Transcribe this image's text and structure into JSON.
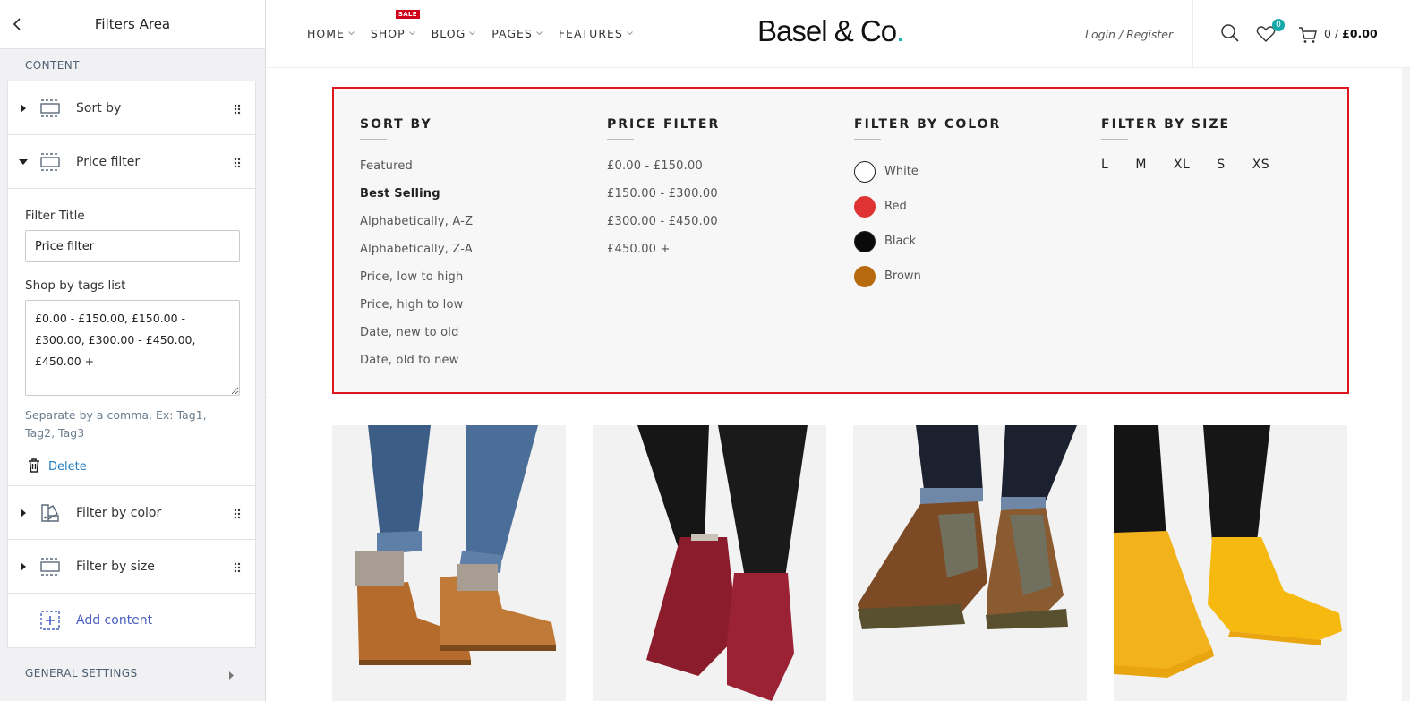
{
  "editor": {
    "title": "Filters Area",
    "content_section": "CONTENT",
    "blocks": [
      {
        "label": "Sort by",
        "expanded": false
      },
      {
        "label": "Price filter",
        "expanded": true
      },
      {
        "label": "Filter by color",
        "expanded": false
      },
      {
        "label": "Filter by size",
        "expanded": false
      }
    ],
    "price_block": {
      "filter_title_label": "Filter Title",
      "filter_title_value": "Price filter",
      "tags_label": "Shop by tags list",
      "tags_value": "£0.00 - £150.00, £150.00 - £300.00, £300.00 - £450.00, £450.00 +",
      "help_text": "Separate by a comma, Ex: Tag1, Tag2, Tag3",
      "delete_label": "Delete"
    },
    "add_content_label": "Add content",
    "general_settings": "GENERAL SETTINGS"
  },
  "store": {
    "nav": [
      {
        "label": "HOME",
        "dropdown": true
      },
      {
        "label": "SHOP",
        "dropdown": true,
        "badge": "SALE"
      },
      {
        "label": "BLOG",
        "dropdown": true
      },
      {
        "label": "PAGES",
        "dropdown": true
      },
      {
        "label": "FEATURES",
        "dropdown": true
      }
    ],
    "logo_text": "Basel & Co",
    "logo_dot": ".",
    "login": "Login / Register",
    "wishlist_count": "0",
    "cart_count": "0 / ",
    "cart_total": "£0.00",
    "accent_color": "#16a9a9",
    "filters": {
      "sort_by": {
        "title": "SORT BY",
        "items": [
          "Featured",
          "Best Selling",
          "Alphabetically, A-Z",
          "Alphabetically, Z-A",
          "Price, low to high",
          "Price, high to low",
          "Date, new to old",
          "Date, old to new"
        ],
        "active": "Best Selling"
      },
      "price_filter": {
        "title": "PRICE FILTER",
        "items": [
          "£0.00 - £150.00",
          "£150.00 - £300.00",
          "£300.00 - £450.00",
          "£450.00 +"
        ]
      },
      "color_filter": {
        "title": "FILTER BY COLOR",
        "items": [
          {
            "label": "White",
            "color": "#ffffff"
          },
          {
            "label": "Red",
            "color": "#e03434"
          },
          {
            "label": "Black",
            "color": "#0a0a0a"
          },
          {
            "label": "Brown",
            "color": "#b86a0e"
          }
        ]
      },
      "size_filter": {
        "title": "FILTER BY SIZE",
        "items": [
          "L",
          "M",
          "XL",
          "S",
          "XS"
        ]
      }
    },
    "products": [
      {
        "image": "tan suede desert boots with jeans"
      },
      {
        "image": "burgundy knit slipper boots"
      },
      {
        "image": "brown leather hiking boots"
      },
      {
        "image": "yellow high-top sneakers"
      }
    ]
  }
}
